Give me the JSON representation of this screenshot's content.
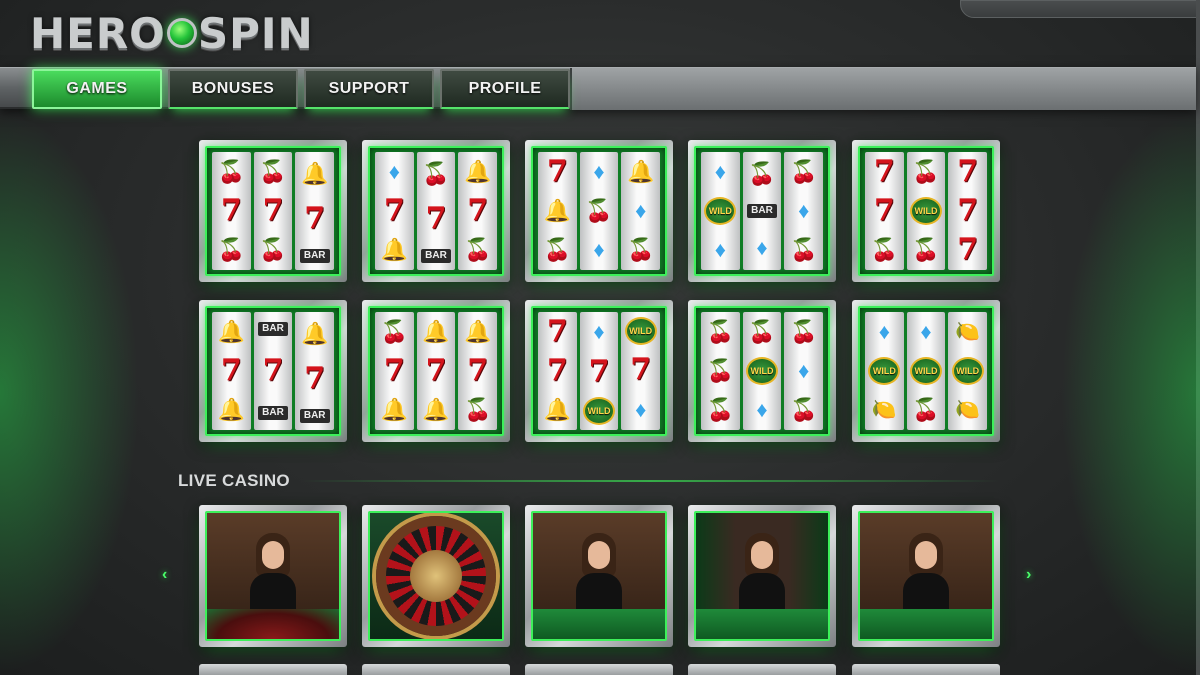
{
  "brand": {
    "logo_text_left": "HERO",
    "logo_text_right": "SPIN"
  },
  "nav": {
    "tabs": [
      {
        "label": "GAMES",
        "active": true
      },
      {
        "label": "BONUSES",
        "active": false
      },
      {
        "label": "SUPPORT",
        "active": false
      },
      {
        "label": "PROFILE",
        "active": false
      }
    ]
  },
  "colors": {
    "accent": "#3df05a",
    "active_tab": "#2fb544",
    "seven": "#d4141c"
  },
  "slots": [
    {
      "reels": [
        [
          "cherry",
          "seven",
          "cherry"
        ],
        [
          "cherry",
          "seven",
          "cherry"
        ],
        [
          "bell",
          "seven",
          "bar"
        ]
      ]
    },
    {
      "reels": [
        [
          "diamond",
          "seven",
          "bell"
        ],
        [
          "cherry",
          "seven",
          "bar"
        ],
        [
          "bell",
          "seven",
          "cherry"
        ]
      ]
    },
    {
      "reels": [
        [
          "seven",
          "bell",
          "cherry"
        ],
        [
          "diamond",
          "cherry",
          "diamond"
        ],
        [
          "bell",
          "diamond",
          "cherry"
        ]
      ]
    },
    {
      "reels": [
        [
          "diamond",
          "wild",
          "diamond"
        ],
        [
          "cherry",
          "bar",
          "diamond"
        ],
        [
          "cherry",
          "diamond",
          "cherry"
        ]
      ]
    },
    {
      "reels": [
        [
          "seven",
          "seven",
          "cherry"
        ],
        [
          "cherry",
          "wild",
          "cherry"
        ],
        [
          "seven",
          "seven",
          "seven"
        ]
      ]
    },
    {
      "reels": [
        [
          "bell",
          "seven",
          "bell"
        ],
        [
          "bar",
          "seven",
          "bar"
        ],
        [
          "bell",
          "seven",
          "bar"
        ]
      ]
    },
    {
      "reels": [
        [
          "cherry",
          "seven",
          "bell"
        ],
        [
          "bell",
          "seven",
          "bell"
        ],
        [
          "bell",
          "seven",
          "cherry"
        ]
      ]
    },
    {
      "reels": [
        [
          "seven",
          "seven",
          "bell"
        ],
        [
          "diamond",
          "seven",
          "wild"
        ],
        [
          "wild",
          "seven",
          "diamond"
        ]
      ]
    },
    {
      "reels": [
        [
          "cherry",
          "cherry",
          "cherry"
        ],
        [
          "cherry",
          "wild",
          "diamond"
        ],
        [
          "cherry",
          "diamond",
          "cherry"
        ]
      ]
    },
    {
      "reels": [
        [
          "diamond",
          "wild",
          "lemon"
        ],
        [
          "diamond",
          "wild",
          "cherry"
        ],
        [
          "lemon",
          "wild",
          "lemon"
        ]
      ]
    }
  ],
  "symbols": {
    "cherry": "🍒",
    "bell": "🔔",
    "diamond": "♦",
    "lemon": "🍋",
    "seven": "7",
    "bar": "BAR",
    "wild": "WILD"
  },
  "live_casino": {
    "title": "LIVE CASINO",
    "prev_icon": "‹",
    "next_icon": "›",
    "tables": [
      {
        "type": "roulette-dealer"
      },
      {
        "type": "roulette-wheel"
      },
      {
        "type": "blackjack-dealer"
      },
      {
        "type": "blackjack-dealer"
      },
      {
        "type": "blackjack-dealer"
      }
    ]
  }
}
